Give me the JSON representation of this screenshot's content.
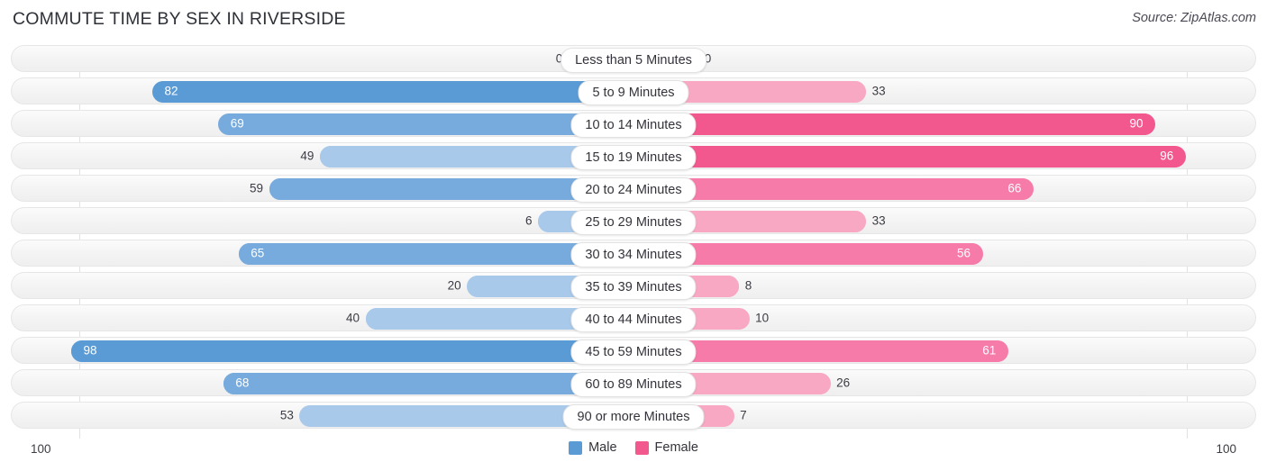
{
  "header": {
    "title": "COMMUTE TIME BY SEX IN RIVERSIDE",
    "source": "Source: ZipAtlas.com"
  },
  "legend": {
    "items": [
      {
        "label": "Male",
        "color": "#5b9bd5"
      },
      {
        "label": "Female",
        "color": "#f2588e"
      }
    ]
  },
  "axis": {
    "left_end": "100",
    "right_end": "100",
    "max": 100
  },
  "chart_data": {
    "type": "bar",
    "orientation": "horizontal-diverging",
    "title": "COMMUTE TIME BY SEX IN RIVERSIDE",
    "xlabel": "",
    "ylabel": "",
    "xlim": [
      100,
      100
    ],
    "grid": true,
    "legend_position": "bottom-center",
    "categories": [
      "Less than 5 Minutes",
      "5 to 9 Minutes",
      "10 to 14 Minutes",
      "15 to 19 Minutes",
      "20 to 24 Minutes",
      "25 to 29 Minutes",
      "30 to 34 Minutes",
      "35 to 39 Minutes",
      "40 to 44 Minutes",
      "45 to 59 Minutes",
      "60 to 89 Minutes",
      "90 or more Minutes"
    ],
    "series": [
      {
        "name": "Male",
        "side": "left",
        "values": [
          0,
          82,
          69,
          49,
          59,
          6,
          65,
          20,
          40,
          98,
          68,
          53
        ]
      },
      {
        "name": "Female",
        "side": "right",
        "values": [
          0,
          33,
          90,
          96,
          66,
          33,
          56,
          8,
          10,
          61,
          26,
          7
        ]
      }
    ]
  },
  "rows": [
    {
      "label": "Less than 5 Minutes",
      "male": "0",
      "female": "0"
    },
    {
      "label": "5 to 9 Minutes",
      "male": "82",
      "female": "33"
    },
    {
      "label": "10 to 14 Minutes",
      "male": "69",
      "female": "90"
    },
    {
      "label": "15 to 19 Minutes",
      "male": "49",
      "female": "96"
    },
    {
      "label": "20 to 24 Minutes",
      "male": "59",
      "female": "66"
    },
    {
      "label": "25 to 29 Minutes",
      "male": "6",
      "female": "33"
    },
    {
      "label": "30 to 34 Minutes",
      "male": "65",
      "female": "56"
    },
    {
      "label": "35 to 39 Minutes",
      "male": "20",
      "female": "8"
    },
    {
      "label": "40 to 44 Minutes",
      "male": "40",
      "female": "10"
    },
    {
      "label": "45 to 59 Minutes",
      "male": "98",
      "female": "61"
    },
    {
      "label": "60 to 89 Minutes",
      "male": "68",
      "female": "26"
    },
    {
      "label": "90 or more Minutes",
      "male": "53",
      "female": "7"
    }
  ],
  "colors": {
    "male_dark": "#5b9bd5",
    "male_mid": "#77aadd",
    "male_light": "#a9c9ea",
    "female_dark": "#f2588e",
    "female_mid": "#f67ba8",
    "female_light": "#f9a8c4",
    "track": "#f3f3f3",
    "text": "#3c3c44"
  }
}
